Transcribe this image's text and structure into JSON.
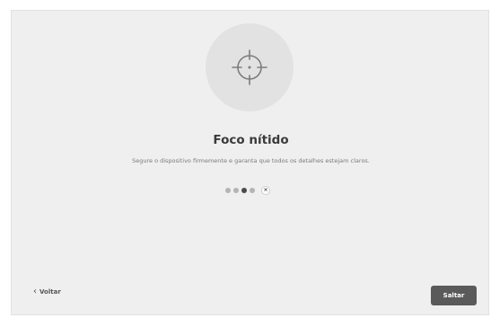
{
  "screen": {
    "title": "Foco nítido",
    "description": "Segure o dispositivo firmemente e garanta que todos os detalhes estejam claros.",
    "icon": "crosshair-icon"
  },
  "stepper": {
    "total_steps": 4,
    "current_step": 3,
    "close_symbol": "×"
  },
  "nav": {
    "back_label": "Voltar",
    "skip_label": "Saltar"
  }
}
